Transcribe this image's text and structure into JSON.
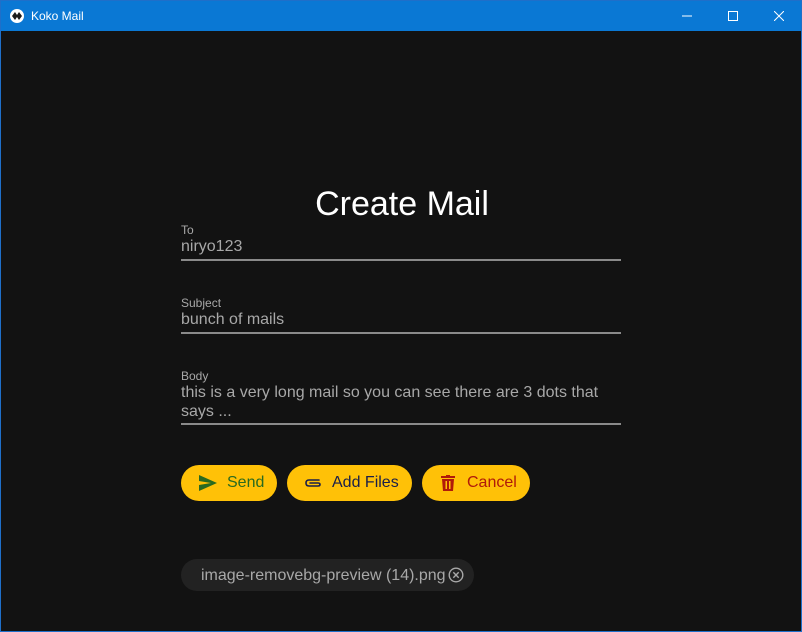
{
  "window": {
    "title": "Koko Mail"
  },
  "page": {
    "title": "Create Mail"
  },
  "form": {
    "to": {
      "label": "To",
      "value": "niryo123"
    },
    "subject": {
      "label": "Subject",
      "value": "bunch of mails"
    },
    "body": {
      "label": "Body",
      "value": "this is a very long mail so you can see there are 3 dots that says ..."
    }
  },
  "actions": {
    "send_label": "Send",
    "add_files_label": "Add Files",
    "cancel_label": "Cancel"
  },
  "attachments": [
    {
      "name": "image-removebg-preview (14).png"
    }
  ],
  "icons": {
    "app": "kivy-logo-icon",
    "send": "send-icon",
    "attach": "paperclip-icon",
    "delete": "trash-icon",
    "chip_remove": "close-circle-icon"
  },
  "colors": {
    "titlebar": "#0a78d4",
    "background": "#121212",
    "button": "#ffc107",
    "send_text": "#2a6a1f",
    "files_text": "#1a1f4a",
    "cancel_text": "#b01a0a"
  }
}
